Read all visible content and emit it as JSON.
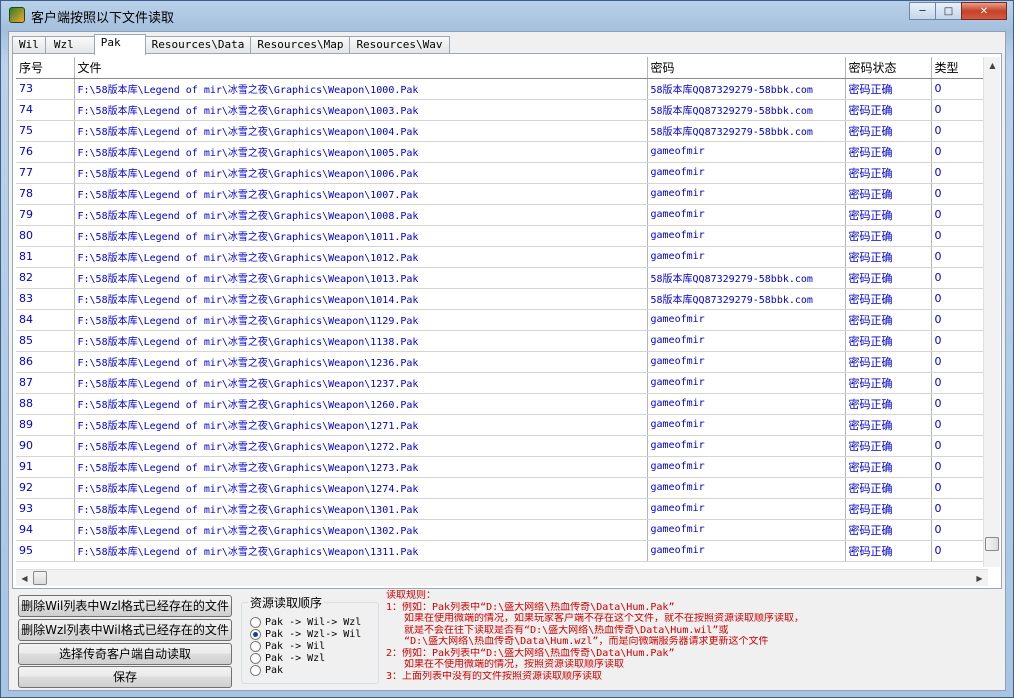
{
  "window": {
    "title": "客户端按照以下文件读取"
  },
  "tabs": [
    {
      "label": "Wil"
    },
    {
      "label": "Wzl"
    },
    {
      "label": "Pak"
    },
    {
      "label": "Resources\\Data"
    },
    {
      "label": "Resources\\Map"
    },
    {
      "label": "Resources\\Wav"
    }
  ],
  "grid": {
    "columns": [
      "序号",
      "文件",
      "密码",
      "密码状态",
      "类型"
    ],
    "rows": [
      {
        "idx": "73",
        "file": "F:\\58版本库\\Legend of mir\\冰雪之夜\\Graphics\\Weapon\\1000.Pak",
        "pwd": "58版本库QQ87329279-58bbk.com",
        "status": "密码正确",
        "type": "0"
      },
      {
        "idx": "74",
        "file": "F:\\58版本库\\Legend of mir\\冰雪之夜\\Graphics\\Weapon\\1003.Pak",
        "pwd": "58版本库QQ87329279-58bbk.com",
        "status": "密码正确",
        "type": "0"
      },
      {
        "idx": "75",
        "file": "F:\\58版本库\\Legend of mir\\冰雪之夜\\Graphics\\Weapon\\1004.Pak",
        "pwd": "58版本库QQ87329279-58bbk.com",
        "status": "密码正确",
        "type": "0"
      },
      {
        "idx": "76",
        "file": "F:\\58版本库\\Legend of mir\\冰雪之夜\\Graphics\\Weapon\\1005.Pak",
        "pwd": "gameofmir",
        "status": "密码正确",
        "type": "0"
      },
      {
        "idx": "77",
        "file": "F:\\58版本库\\Legend of mir\\冰雪之夜\\Graphics\\Weapon\\1006.Pak",
        "pwd": "gameofmir",
        "status": "密码正确",
        "type": "0"
      },
      {
        "idx": "78",
        "file": "F:\\58版本库\\Legend of mir\\冰雪之夜\\Graphics\\Weapon\\1007.Pak",
        "pwd": "gameofmir",
        "status": "密码正确",
        "type": "0"
      },
      {
        "idx": "79",
        "file": "F:\\58版本库\\Legend of mir\\冰雪之夜\\Graphics\\Weapon\\1008.Pak",
        "pwd": "gameofmir",
        "status": "密码正确",
        "type": "0"
      },
      {
        "idx": "80",
        "file": "F:\\58版本库\\Legend of mir\\冰雪之夜\\Graphics\\Weapon\\1011.Pak",
        "pwd": "gameofmir",
        "status": "密码正确",
        "type": "0"
      },
      {
        "idx": "81",
        "file": "F:\\58版本库\\Legend of mir\\冰雪之夜\\Graphics\\Weapon\\1012.Pak",
        "pwd": "gameofmir",
        "status": "密码正确",
        "type": "0"
      },
      {
        "idx": "82",
        "file": "F:\\58版本库\\Legend of mir\\冰雪之夜\\Graphics\\Weapon\\1013.Pak",
        "pwd": "58版本库QQ87329279-58bbk.com",
        "status": "密码正确",
        "type": "0"
      },
      {
        "idx": "83",
        "file": "F:\\58版本库\\Legend of mir\\冰雪之夜\\Graphics\\Weapon\\1014.Pak",
        "pwd": "58版本库QQ87329279-58bbk.com",
        "status": "密码正确",
        "type": "0"
      },
      {
        "idx": "84",
        "file": "F:\\58版本库\\Legend of mir\\冰雪之夜\\Graphics\\Weapon\\1129.Pak",
        "pwd": "gameofmir",
        "status": "密码正确",
        "type": "0"
      },
      {
        "idx": "85",
        "file": "F:\\58版本库\\Legend of mir\\冰雪之夜\\Graphics\\Weapon\\1138.Pak",
        "pwd": "gameofmir",
        "status": "密码正确",
        "type": "0"
      },
      {
        "idx": "86",
        "file": "F:\\58版本库\\Legend of mir\\冰雪之夜\\Graphics\\Weapon\\1236.Pak",
        "pwd": "gameofmir",
        "status": "密码正确",
        "type": "0"
      },
      {
        "idx": "87",
        "file": "F:\\58版本库\\Legend of mir\\冰雪之夜\\Graphics\\Weapon\\1237.Pak",
        "pwd": "gameofmir",
        "status": "密码正确",
        "type": "0"
      },
      {
        "idx": "88",
        "file": "F:\\58版本库\\Legend of mir\\冰雪之夜\\Graphics\\Weapon\\1260.Pak",
        "pwd": "gameofmir",
        "status": "密码正确",
        "type": "0"
      },
      {
        "idx": "89",
        "file": "F:\\58版本库\\Legend of mir\\冰雪之夜\\Graphics\\Weapon\\1271.Pak",
        "pwd": "gameofmir",
        "status": "密码正确",
        "type": "0"
      },
      {
        "idx": "90",
        "file": "F:\\58版本库\\Legend of mir\\冰雪之夜\\Graphics\\Weapon\\1272.Pak",
        "pwd": "gameofmir",
        "status": "密码正确",
        "type": "0"
      },
      {
        "idx": "91",
        "file": "F:\\58版本库\\Legend of mir\\冰雪之夜\\Graphics\\Weapon\\1273.Pak",
        "pwd": "gameofmir",
        "status": "密码正确",
        "type": "0"
      },
      {
        "idx": "92",
        "file": "F:\\58版本库\\Legend of mir\\冰雪之夜\\Graphics\\Weapon\\1274.Pak",
        "pwd": "gameofmir",
        "status": "密码正确",
        "type": "0"
      },
      {
        "idx": "93",
        "file": "F:\\58版本库\\Legend of mir\\冰雪之夜\\Graphics\\Weapon\\1301.Pak",
        "pwd": "gameofmir",
        "status": "密码正确",
        "type": "0"
      },
      {
        "idx": "94",
        "file": "F:\\58版本库\\Legend of mir\\冰雪之夜\\Graphics\\Weapon\\1302.Pak",
        "pwd": "gameofmir",
        "status": "密码正确",
        "type": "0"
      },
      {
        "idx": "95",
        "file": "F:\\58版本库\\Legend of mir\\冰雪之夜\\Graphics\\Weapon\\1311.Pak",
        "pwd": "gameofmir",
        "status": "密码正确",
        "type": "0"
      }
    ]
  },
  "buttons": {
    "delete_wil": "删除Wil列表中Wzl格式已经存在的文件",
    "delete_wzl": "删除Wzl列表中Wil格式已经存在的文件",
    "choose_client": "选择传奇客户端自动读取",
    "save": "保存"
  },
  "order_group": {
    "title": "资源读取顺序",
    "options": [
      {
        "label": "Pak -> Wil-> Wzl",
        "selected": false
      },
      {
        "label": "Pak -> Wzl-> Wil",
        "selected": true
      },
      {
        "label": "Pak -> Wil",
        "selected": false
      },
      {
        "label": "Pak -> Wzl",
        "selected": false
      },
      {
        "label": "Pak",
        "selected": false
      }
    ]
  },
  "rules": {
    "lines": [
      "读取规则：",
      "1：例如：Pak列表中“D:\\盛大网络\\热血传奇\\Data\\Hum.Pak”",
      "   如果在使用微端的情况，如果玩家客户端不存在这个文件，就不在按照资源读取顺序读取，",
      "   就是不会在往下读取是否有“D:\\盛大网络\\热血传奇\\Data\\Hum.wil”或",
      "   “D:\\盛大网络\\热血传奇\\Data\\Hum.wzl”，而是向微端服务器请求更新这个文件",
      "2：例如：Pak列表中“D:\\盛大网络\\热血传奇\\Data\\Hum.Pak”",
      "   如果在不使用微端的情况，按照资源读取顺序读取",
      "3：上面列表中没有的文件按照资源读取顺序读取"
    ],
    "color": "#d00000"
  },
  "icons": {
    "minimize": "minimize-icon",
    "maximize": "maximize-icon",
    "close": "close-icon"
  }
}
